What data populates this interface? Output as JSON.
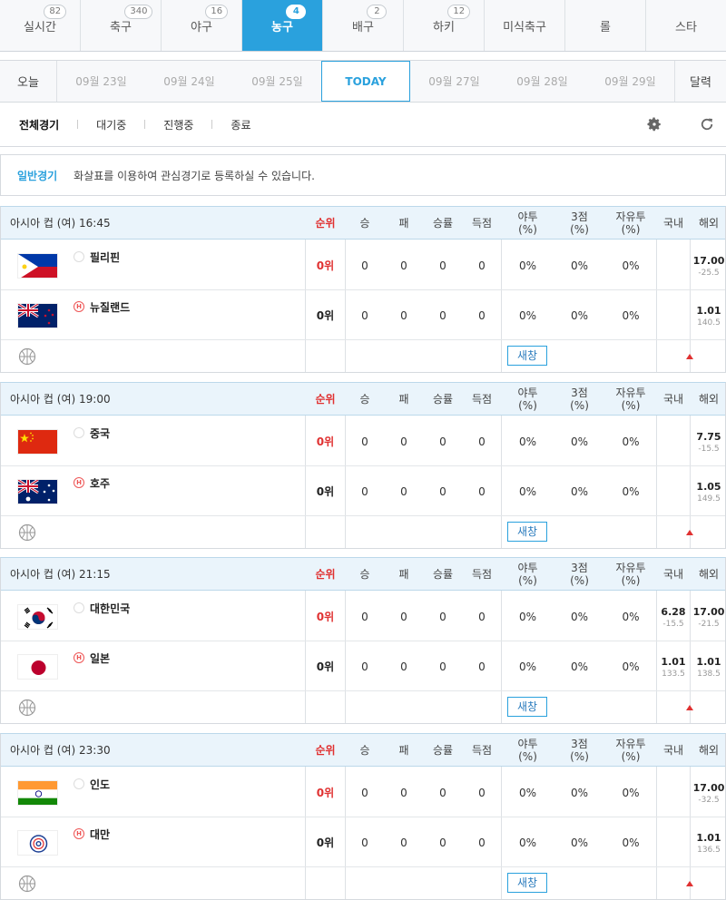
{
  "sports_tabs": [
    {
      "label": "실시간",
      "count": "82",
      "active": false
    },
    {
      "label": "축구",
      "count": "340",
      "active": false
    },
    {
      "label": "야구",
      "count": "16",
      "active": false
    },
    {
      "label": "농구",
      "count": "4",
      "active": true
    },
    {
      "label": "배구",
      "count": "2",
      "active": false
    },
    {
      "label": "하키",
      "count": "12",
      "active": false
    },
    {
      "label": "미식축구",
      "count": "",
      "active": false
    },
    {
      "label": "롤",
      "count": "",
      "active": false
    },
    {
      "label": "스타",
      "count": "",
      "active": false
    }
  ],
  "dates": {
    "today_btn": "오늘",
    "days": [
      "09월 23일",
      "09월 24일",
      "09월 25일",
      "TODAY",
      "09월 27일",
      "09월 28일",
      "09월 29일"
    ],
    "calendar_btn": "달력"
  },
  "filters": [
    "전체경기",
    "대기중",
    "진행중",
    "종료"
  ],
  "icons": {
    "settings": "gear-icon",
    "refresh": "refresh-icon",
    "court": "basketball-court-icon",
    "home": "home-badge-icon"
  },
  "notice": {
    "label": "일반경기",
    "message": "화살표를 이용하여 관심경기로 등록하실 수 있습니다."
  },
  "columns": {
    "rank": "순위",
    "win": "승",
    "loss": "패",
    "rate": "승률",
    "points": "득점",
    "fg": "야투\n(%)",
    "three": "3점\n(%)",
    "ft": "자유투\n(%)",
    "domestic": "국내",
    "overseas": "해외"
  },
  "new_window_label": "새창",
  "colors": {
    "accent": "#2aa1dd",
    "rank_red": "#e03131",
    "header_bg": "#eaf4fb"
  },
  "games": [
    {
      "title": "아시아 컵 (여)  16:45",
      "teams": [
        {
          "name": "필리핀",
          "flag": "philippines",
          "home": false,
          "rank": "0위",
          "win": "0",
          "loss": "0",
          "rate": "0",
          "points": "0",
          "fg": "0%",
          "three": "0%",
          "ft": "0%",
          "domestic": {
            "odds": "",
            "sub": ""
          },
          "overseas": {
            "odds": "17.00",
            "sub": "-25.5"
          }
        },
        {
          "name": "뉴질랜드",
          "flag": "newzealand",
          "home": true,
          "rank": "0위",
          "win": "0",
          "loss": "0",
          "rate": "0",
          "points": "0",
          "fg": "0%",
          "three": "0%",
          "ft": "0%",
          "domestic": {
            "odds": "",
            "sub": ""
          },
          "overseas": {
            "odds": "1.01",
            "sub": "140.5"
          }
        }
      ]
    },
    {
      "title": "아시아 컵 (여)  19:00",
      "teams": [
        {
          "name": "중국",
          "flag": "china",
          "home": false,
          "rank": "0위",
          "win": "0",
          "loss": "0",
          "rate": "0",
          "points": "0",
          "fg": "0%",
          "three": "0%",
          "ft": "0%",
          "domestic": {
            "odds": "",
            "sub": ""
          },
          "overseas": {
            "odds": "7.75",
            "sub": "-15.5"
          }
        },
        {
          "name": "호주",
          "flag": "australia",
          "home": true,
          "rank": "0위",
          "win": "0",
          "loss": "0",
          "rate": "0",
          "points": "0",
          "fg": "0%",
          "three": "0%",
          "ft": "0%",
          "domestic": {
            "odds": "",
            "sub": ""
          },
          "overseas": {
            "odds": "1.05",
            "sub": "149.5"
          }
        }
      ]
    },
    {
      "title": "아시아 컵 (여)  21:15",
      "teams": [
        {
          "name": "대한민국",
          "flag": "korea",
          "home": false,
          "rank": "0위",
          "win": "0",
          "loss": "0",
          "rate": "0",
          "points": "0",
          "fg": "0%",
          "three": "0%",
          "ft": "0%",
          "domestic": {
            "odds": "6.28",
            "sub": "-15.5"
          },
          "overseas": {
            "odds": "17.00",
            "sub": "-21.5"
          }
        },
        {
          "name": "일본",
          "flag": "japan",
          "home": true,
          "rank": "0위",
          "win": "0",
          "loss": "0",
          "rate": "0",
          "points": "0",
          "fg": "0%",
          "three": "0%",
          "ft": "0%",
          "domestic": {
            "odds": "1.01",
            "sub": "133.5"
          },
          "overseas": {
            "odds": "1.01",
            "sub": "138.5"
          }
        }
      ]
    },
    {
      "title": "아시아 컵 (여)  23:30",
      "teams": [
        {
          "name": "인도",
          "flag": "india",
          "home": false,
          "rank": "0위",
          "win": "0",
          "loss": "0",
          "rate": "0",
          "points": "0",
          "fg": "0%",
          "three": "0%",
          "ft": "0%",
          "domestic": {
            "odds": "",
            "sub": ""
          },
          "overseas": {
            "odds": "17.00",
            "sub": "-32.5"
          }
        },
        {
          "name": "대만",
          "flag": "taiwan",
          "home": true,
          "rank": "0위",
          "win": "0",
          "loss": "0",
          "rate": "0",
          "points": "0",
          "fg": "0%",
          "three": "0%",
          "ft": "0%",
          "domestic": {
            "odds": "",
            "sub": ""
          },
          "overseas": {
            "odds": "1.01",
            "sub": "136.5"
          }
        }
      ]
    }
  ]
}
